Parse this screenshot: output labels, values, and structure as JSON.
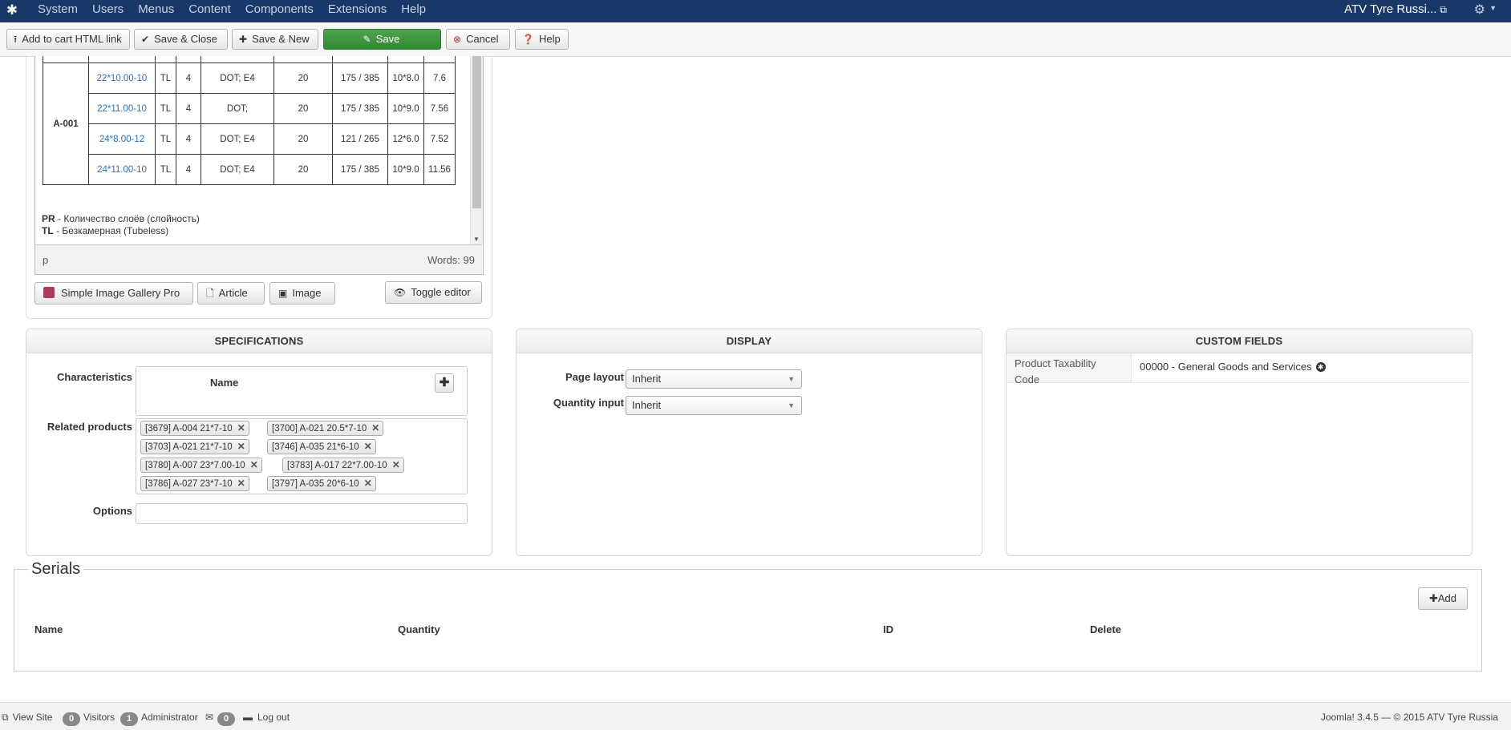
{
  "navbar": {
    "menu": [
      "System",
      "Users",
      "Menus",
      "Content",
      "Components",
      "Extensions",
      "Help"
    ],
    "site_name": "ATV Tyre Russi..."
  },
  "toolbar": {
    "add_to_cart": "Add to cart HTML link",
    "save_close": "Save & Close",
    "save_new": "Save & New",
    "save": "Save",
    "cancel": "Cancel",
    "help": "Help"
  },
  "editor": {
    "model": "A-001",
    "rows": [
      {
        "size": "22*10.00-10",
        "tl": "TL",
        "pr": "4",
        "cert": "DOT; E4",
        "qty": "20",
        "load": "175 / 385",
        "rim": "10*8.0",
        "weight": "7.6"
      },
      {
        "size": "22*11.00-10",
        "tl": "TL",
        "pr": "4",
        "cert": "DOT;",
        "qty": "20",
        "load": "175 / 385",
        "rim": "10*9.0",
        "weight": "7.56"
      },
      {
        "size": "24*8.00-12",
        "tl": "TL",
        "pr": "4",
        "cert": "DOT; E4",
        "qty": "20",
        "load": "121 / 265",
        "rim": "12*6.0",
        "weight": "7.52"
      },
      {
        "size": "24*11.00-10",
        "tl": "TL",
        "pr": "4",
        "cert": "DOT; E4",
        "qty": "20",
        "load": "175 / 385",
        "rim": "10*9.0",
        "weight": "11.56"
      }
    ],
    "legend_pr_key": "PR",
    "legend_pr_text": " - Количество слоёв (слойность)",
    "legend_tl_key": "TL",
    "legend_tl_text": " - Безкамерная (Tubeless)",
    "path": "p",
    "words": "Words: 99",
    "buttons": {
      "gallery": "Simple Image Gallery Pro",
      "article": "Article",
      "image": "Image",
      "toggle": "Toggle editor"
    }
  },
  "specifications": {
    "title": "SPECIFICATIONS",
    "characteristics_label": "Characteristics",
    "name_header": "Name",
    "related_label": "Related products",
    "related": [
      "[3679] A-004 21*7-10",
      "[3700] A-021 20.5*7-10",
      "[3703] A-021 21*7-10",
      "[3746] A-035 21*6-10",
      "[3780] A-007 23*7.00-10",
      "[3783] A-017 22*7.00-10",
      "[3786] A-027 23*7-10",
      "[3797] A-035 20*6-10"
    ],
    "options_label": "Options"
  },
  "display": {
    "title": "DISPLAY",
    "page_layout_label": "Page layout",
    "page_layout_value": "Inherit",
    "quantity_input_label": "Quantity input",
    "quantity_input_value": "Inherit"
  },
  "custom_fields": {
    "title": "CUSTOM FIELDS",
    "key": "Product Taxability Code",
    "value": "00000 - General Goods and Services"
  },
  "serials": {
    "title": "Serials",
    "add": "Add",
    "columns": [
      "Name",
      "Quantity",
      "ID",
      "Delete"
    ]
  },
  "footer": {
    "view_site": "View Site",
    "visitors_count": "0",
    "visitors": "Visitors",
    "admin_count": "1",
    "administrator": "Administrator",
    "messages_count": "0",
    "logout": "Log out",
    "copyright": "Joomla! 3.4.5  —  © 2015 ATV Tyre Russia"
  }
}
